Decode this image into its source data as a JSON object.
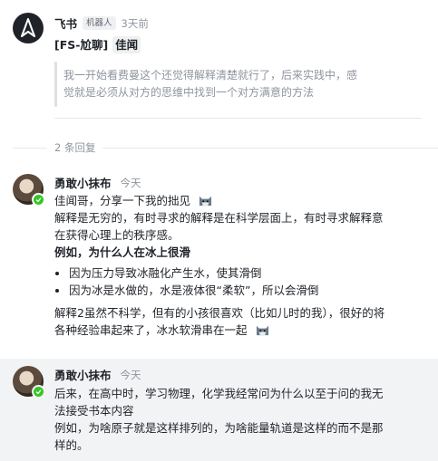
{
  "thread": {
    "sender_name": "飞书",
    "sender_badge": "机器人",
    "sender_time": "3天前",
    "title_prefix": "[FS-尬聊]",
    "title_mention": "佳闻",
    "quote_line1": "我一开始看费曼这个还觉得解释清楚就行了，后来实践中，感",
    "quote_line2": "觉就是必须从对方的思维中找到一个对方满意的方法"
  },
  "replies_label": "2 条回复",
  "replies": [
    {
      "name": "勇敢小抹布",
      "time": "今天",
      "line1": "佳闻哥，分享一下我的拙见",
      "line2": "解释是无穷的，有时寻求的解释是在科学层面上，有时寻求解释意",
      "line3": "在获得心理上的秩序感。",
      "bold_line": "例如，为什么人在冰上很滑",
      "bullets": [
        "因为压力导致冰融化产生水，使其滑倒",
        "因为冰是水做的，水是液体很“柔软”，所以会滑倒"
      ],
      "line4": "解释2虽然不科学，但有的小孩很喜欢（比如儿时的我），很好的将",
      "line5": "各种经验串起来了，冰水软滑串在一起"
    },
    {
      "name": "勇敢小抹布",
      "time": "今天",
      "line1": "后来，在高中时，学习物理，化学我经常问为什么以至于问的我无",
      "line2": "法接受书本内容",
      "line3": "例如，为啥原子就是这样排列的，为啥能量轨道是这样的而不是那",
      "line4": "样的。"
    }
  ],
  "icons": {
    "bot_avatar": "feishu-logo-icon",
    "emoji": "cat-emoji-icon",
    "status": "online-check-icon"
  },
  "colors": {
    "online": "#34c724",
    "highlight_bg": "#f2f3f5",
    "muted_text": "#8f959e"
  }
}
